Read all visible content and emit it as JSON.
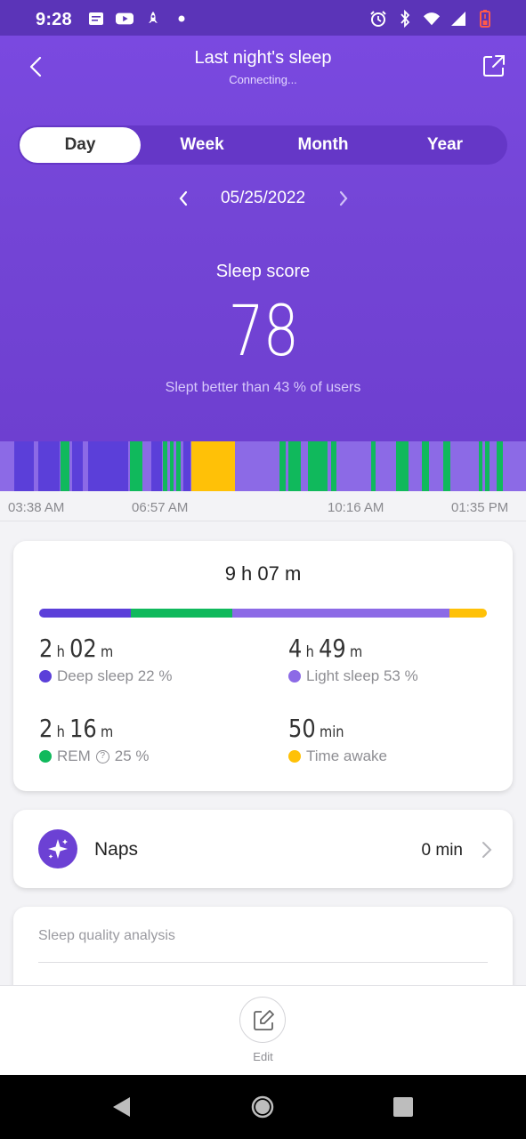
{
  "status_bar": {
    "time": "9:28",
    "left_icons": [
      "notes-icon",
      "youtube-icon",
      "rocket-icon",
      "dot-icon"
    ],
    "right_icons": [
      "alarm-icon",
      "bluetooth-icon",
      "wifi-icon",
      "signal-icon",
      "battery-low-icon"
    ]
  },
  "header": {
    "title": "Last night's sleep",
    "subtitle": "Connecting..."
  },
  "tabs": [
    {
      "label": "Day",
      "active": true
    },
    {
      "label": "Week",
      "active": false
    },
    {
      "label": "Month",
      "active": false
    },
    {
      "label": "Year",
      "active": false
    }
  ],
  "date": "05/25/2022",
  "score": {
    "label": "Sleep score",
    "value": "78",
    "description": "Slept better than 43 % of users"
  },
  "stage_timeline": {
    "ticks": [
      "03:38 AM",
      "06:57 AM",
      "10:16 AM",
      "01:35 PM"
    ]
  },
  "summary": {
    "total": "9 h 07 m",
    "distribution": [
      {
        "stage": "deep",
        "percent": 22
      },
      {
        "stage": "rem",
        "percent": 25
      },
      {
        "stage": "light",
        "percent": 53
      },
      {
        "stage": "awake",
        "percent": 9
      }
    ],
    "stats": {
      "deep": {
        "h": "2",
        "h_unit": "h",
        "m": "02",
        "m_unit": "m",
        "label": "Deep sleep 22 %"
      },
      "light": {
        "h": "4",
        "h_unit": "h",
        "m": "49",
        "m_unit": "m",
        "label": "Light sleep 53 %"
      },
      "rem": {
        "h": "2",
        "h_unit": "h",
        "m": "16",
        "m_unit": "m",
        "label": "REM",
        "percent": "25 %"
      },
      "awake": {
        "value": "50",
        "unit": "min",
        "label": "Time awake"
      }
    }
  },
  "naps": {
    "label": "Naps",
    "value": "0 min"
  },
  "analysis": {
    "title": "Sleep quality analysis"
  },
  "edit": {
    "label": "Edit"
  },
  "colors": {
    "header": "#7445d6",
    "deep": "#5b3fd9",
    "light": "#8c6ae6",
    "rem": "#10b95c",
    "awake": "#ffc107",
    "timeline_bg": "#8c6ae6"
  }
}
